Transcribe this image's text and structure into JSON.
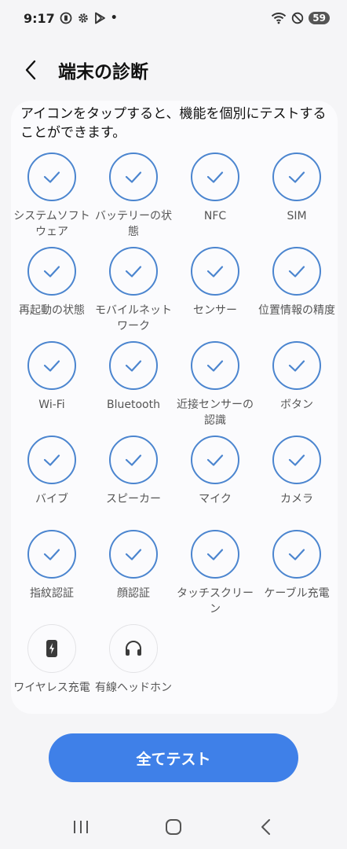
{
  "status_bar": {
    "time": "9:17",
    "battery": "59",
    "dot": "•"
  },
  "header": {
    "title": "端末の診断"
  },
  "intro": "アイコンをタップすると、機能を個別にテストすることができます。",
  "tests": [
    {
      "label": "システムソフトウェア",
      "icon": "check-icon",
      "state": "checked"
    },
    {
      "label": "バッテリーの状態",
      "icon": "check-icon",
      "state": "checked"
    },
    {
      "label": "NFC",
      "icon": "check-icon",
      "state": "checked"
    },
    {
      "label": "SIM",
      "icon": "check-icon",
      "state": "checked"
    },
    {
      "label": "再起動の状態",
      "icon": "check-icon",
      "state": "checked"
    },
    {
      "label": "モバイルネットワーク",
      "icon": "check-icon",
      "state": "checked"
    },
    {
      "label": "センサー",
      "icon": "check-icon",
      "state": "checked"
    },
    {
      "label": "位置情報の精度",
      "icon": "check-icon",
      "state": "checked"
    },
    {
      "label": "Wi-Fi",
      "icon": "check-icon",
      "state": "checked"
    },
    {
      "label": "Bluetooth",
      "icon": "check-icon",
      "state": "checked"
    },
    {
      "label": "近接センサーの認識",
      "icon": "check-icon",
      "state": "checked"
    },
    {
      "label": "ボタン",
      "icon": "check-icon",
      "state": "checked"
    },
    {
      "label": "バイブ",
      "icon": "check-icon",
      "state": "checked"
    },
    {
      "label": "スピーカー",
      "icon": "check-icon",
      "state": "checked"
    },
    {
      "label": "マイク",
      "icon": "check-icon",
      "state": "checked"
    },
    {
      "label": "カメラ",
      "icon": "check-icon",
      "state": "checked"
    },
    {
      "label": "指紋認証",
      "icon": "check-icon",
      "state": "checked"
    },
    {
      "label": "顔認証",
      "icon": "check-icon",
      "state": "checked"
    },
    {
      "label": "タッチスクリーン",
      "icon": "check-icon",
      "state": "checked"
    },
    {
      "label": "ケーブル充電",
      "icon": "check-icon",
      "state": "checked"
    },
    {
      "label": "ワイヤレス充電",
      "icon": "wireless-charging-icon",
      "state": "untested"
    },
    {
      "label": "有線ヘッドホン",
      "icon": "headphones-icon",
      "state": "untested"
    }
  ],
  "all_test_button": "全てテスト",
  "colors": {
    "accent": "#3f80e8",
    "check": "#4b85cf",
    "background": "#f5f5f7",
    "card": "#fbfbfd"
  }
}
